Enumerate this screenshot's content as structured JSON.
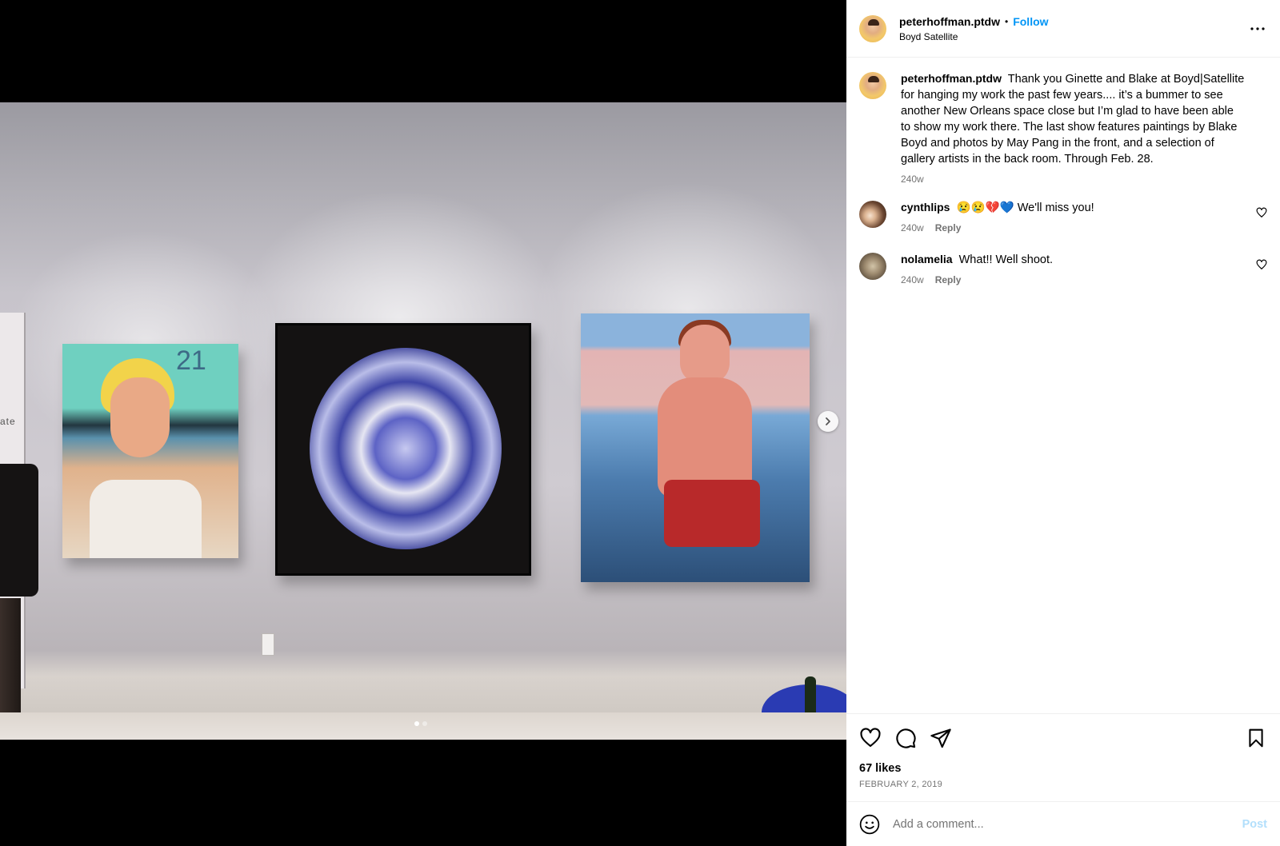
{
  "post": {
    "username": "peterhoffman.ptdw",
    "separator": "•",
    "follow_label": "Follow",
    "location": "Boyd Satellite",
    "more_icon": "more-options-icon"
  },
  "media": {
    "photo_wall_text": "ate",
    "painting_number": "21",
    "carousel_count": 2,
    "carousel_active": 1
  },
  "caption": {
    "username": "peterhoffman.ptdw",
    "text": "Thank you Ginette and Blake at Boyd|Satellite for hanging my work the past few years.... it’s a bummer to see another New Orleans space close but I’m glad to have been able to show my work there. The last show features paintings by Blake Boyd and photos by May Pang in the front, and a selection of gallery artists in the back room. Through Feb. 28.",
    "time": "240w"
  },
  "comments": [
    {
      "username": "cynthlips",
      "text": "😢😢💔💙 We'll miss you!",
      "time": "240w",
      "reply_label": "Reply"
    },
    {
      "username": "nolamelia",
      "text": "What!! Well shoot.",
      "time": "240w",
      "reply_label": "Reply"
    }
  ],
  "actions": {
    "likes": "67 likes",
    "date": "FEBRUARY 2, 2019"
  },
  "add_comment": {
    "placeholder": "Add a comment...",
    "post_label": "Post"
  },
  "colors": {
    "accent": "#0095f6",
    "muted": "#737373",
    "post_disabled": "#b2dffc"
  }
}
